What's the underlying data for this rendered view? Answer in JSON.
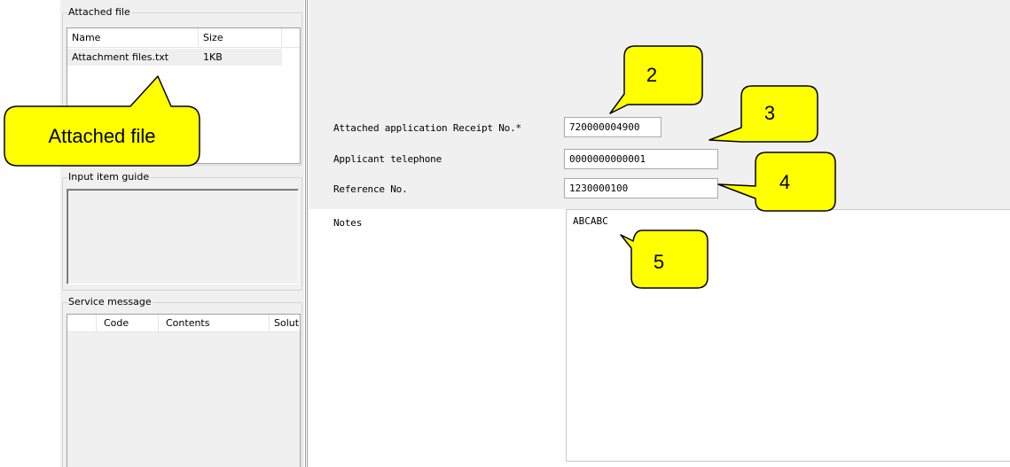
{
  "attached_file": {
    "title": "Attached file",
    "columns": [
      "Name",
      "Size"
    ],
    "rows": [
      {
        "name": "Attachment files.txt",
        "size": "1KB"
      }
    ]
  },
  "input_item_guide": {
    "title": "Input item guide"
  },
  "service_message": {
    "title": "Service message",
    "columns": [
      "Code",
      "Contents",
      "Solut"
    ]
  },
  "form": {
    "receipt_label": "Attached application Receipt No.*",
    "receipt_value": "720000004900",
    "telephone_label": "Applicant telephone",
    "telephone_value": "0000000000001",
    "reference_label": "Reference No.",
    "reference_value": "1230000100",
    "notes_label": "Notes",
    "notes_value": "ABCABC"
  },
  "callouts": {
    "attached_file": "Attached file",
    "c2": "2",
    "c3": "3",
    "c4": "4",
    "c5": "5",
    "fill_color": "#ffff00"
  }
}
